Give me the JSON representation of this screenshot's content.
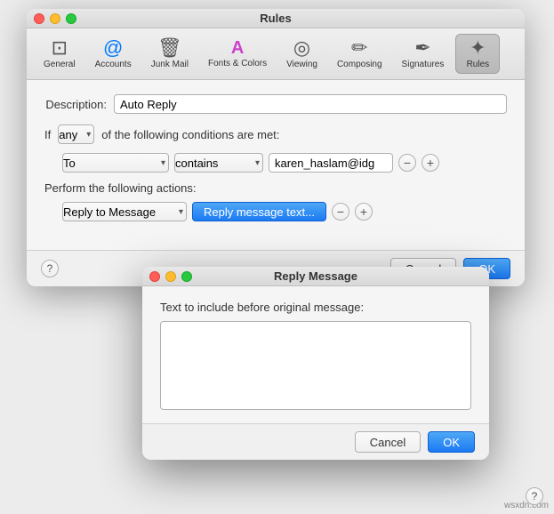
{
  "rules_window": {
    "title": "Rules",
    "traffic_lights": {
      "close": "close",
      "minimize": "minimize",
      "maximize": "maximize"
    },
    "toolbar": {
      "items": [
        {
          "id": "general",
          "label": "General",
          "icon": "⊡"
        },
        {
          "id": "accounts",
          "label": "Accounts",
          "icon": "@"
        },
        {
          "id": "junk_mail",
          "label": "Junk Mail",
          "icon": "🗑"
        },
        {
          "id": "fonts_colors",
          "label": "Fonts & Colors",
          "icon": "A"
        },
        {
          "id": "viewing",
          "label": "Viewing",
          "icon": "◎"
        },
        {
          "id": "composing",
          "label": "Composing",
          "icon": "✏"
        },
        {
          "id": "signatures",
          "label": "Signatures",
          "icon": "✒"
        },
        {
          "id": "rules",
          "label": "Rules",
          "icon": "✦"
        }
      ]
    },
    "form": {
      "description_label": "Description:",
      "description_value": "Auto Reply",
      "if_label": "If",
      "if_condition": "any",
      "if_suffix": "of the following conditions are met:",
      "condition_field": "To",
      "condition_op": "contains",
      "condition_value": "karen_haslam@idg",
      "actions_label": "Perform the following actions:",
      "action_type": "Reply to Message",
      "action_btn": "Reply message text..."
    },
    "buttons": {
      "cancel": "Cancel",
      "ok": "OK",
      "help": "?"
    }
  },
  "reply_dialog": {
    "title": "Reply Message",
    "label": "Text to include before original message:",
    "textarea_value": "",
    "buttons": {
      "cancel": "Cancel",
      "ok": "OK"
    },
    "help": "?"
  },
  "watermark": "wsxdn.com"
}
